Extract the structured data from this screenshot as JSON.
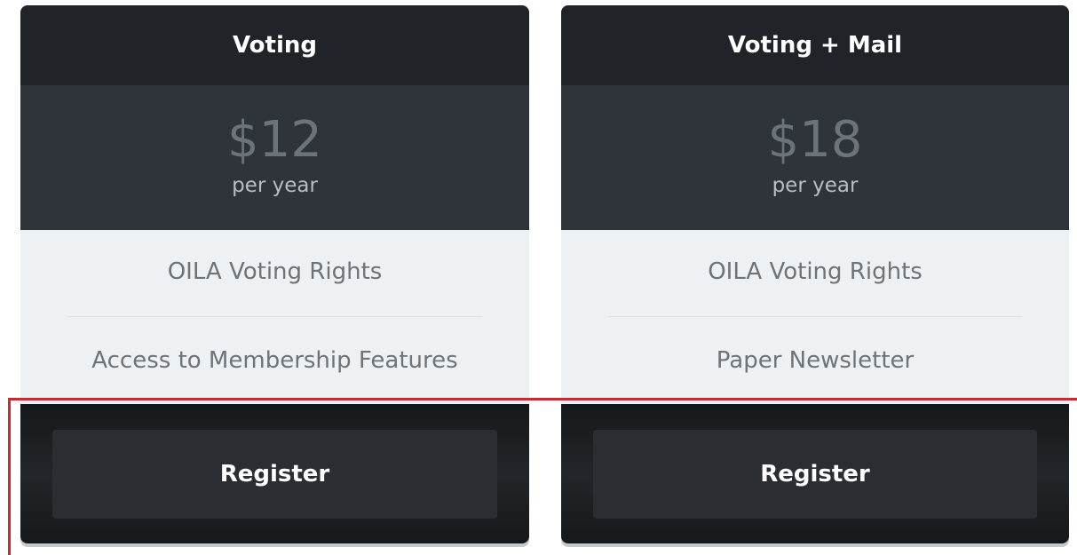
{
  "plans": [
    {
      "name": "Voting",
      "price": "$12",
      "period": "per year",
      "features": [
        "OILA Voting Rights",
        "Access to Membership Features"
      ],
      "button_label": "Register"
    },
    {
      "name": "Voting + Mail",
      "price": "$18",
      "period": "per year",
      "features": [
        "OILA Voting Rights",
        "Paper Newsletter"
      ],
      "button_label": "Register"
    }
  ],
  "colors": {
    "header_bg": "#202429",
    "price_bg": "#2e343a",
    "features_bg": "#eef1f3",
    "footer_bg": "#16181b",
    "button_bg": "#2a2e33",
    "highlight": "#d6232f"
  }
}
